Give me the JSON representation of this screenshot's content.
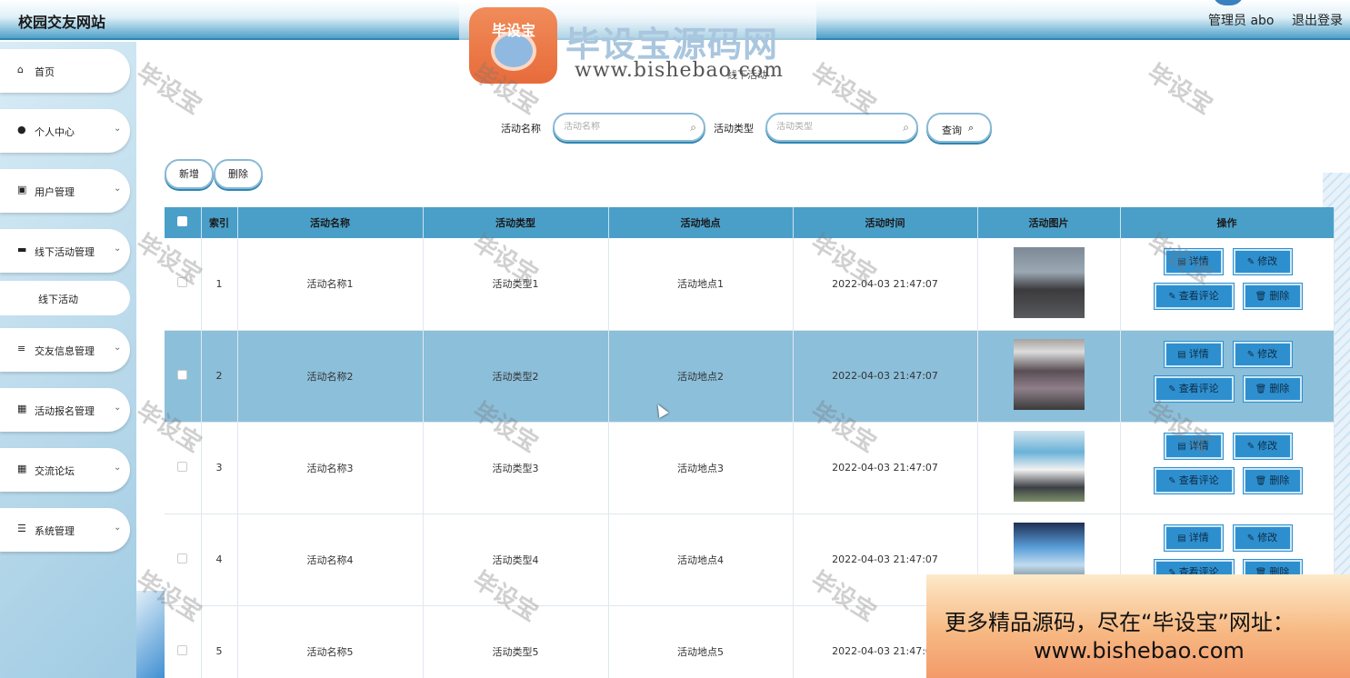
{
  "header": {
    "site_title": "校园交友网站",
    "admin_label": "管理员 abo",
    "logout_label": "退出登录"
  },
  "watermark_banner": {
    "logo_text": "毕设宝",
    "title": "毕设宝源码网",
    "url": "www.bishebao.com",
    "tile_text": "毕设宝"
  },
  "sidebar": {
    "items": [
      {
        "label": "首页",
        "icon": "home-icon"
      },
      {
        "label": "个人中心",
        "icon": "user-icon"
      },
      {
        "label": "用户管理",
        "icon": "clipboard-icon"
      },
      {
        "label": "线下活动管理",
        "icon": "briefcase-icon"
      },
      {
        "label": "交友信息管理",
        "icon": "list-icon"
      },
      {
        "label": "活动报名管理",
        "icon": "grid-icon"
      },
      {
        "label": "交流论坛",
        "icon": "grid-icon"
      },
      {
        "label": "系统管理",
        "icon": "sliders-icon"
      }
    ],
    "sub_item": "线下活动"
  },
  "breadcrumb": "线下活动",
  "search": {
    "name_label": "活动名称",
    "name_placeholder": "活动名称",
    "type_label": "活动类型",
    "type_placeholder": "活动类型",
    "query_label": "查询"
  },
  "toolbar": {
    "add_label": "新增",
    "delete_label": "删除"
  },
  "table": {
    "headers": [
      "索引",
      "活动名称",
      "活动类型",
      "活动地点",
      "活动时间",
      "活动图片",
      "操作"
    ],
    "rows": [
      {
        "index": "1",
        "name": "活动名称1",
        "type": "活动类型1",
        "place": "活动地点1",
        "time": "2022-04-03 21:47:07"
      },
      {
        "index": "2",
        "name": "活动名称2",
        "type": "活动类型2",
        "place": "活动地点2",
        "time": "2022-04-03 21:47:07"
      },
      {
        "index": "3",
        "name": "活动名称3",
        "type": "活动类型3",
        "place": "活动地点3",
        "time": "2022-04-03 21:47:07"
      },
      {
        "index": "4",
        "name": "活动名称4",
        "type": "活动类型4",
        "place": "活动地点4",
        "time": "2022-04-03 21:47:07"
      },
      {
        "index": "5",
        "name": "活动名称5",
        "type": "活动类型5",
        "place": "活动地点5",
        "time": "2022-04-03 21:47:07"
      }
    ],
    "actions": {
      "detail": "详情",
      "edit": "修改",
      "comments": "查看评论",
      "delete": "删除"
    },
    "highlight_row_index": "2"
  },
  "promo": {
    "line1": "更多精品源码，尽在“毕设宝”网址：",
    "line2": "www.bishebao.com"
  },
  "colors": {
    "header_accent": "#2f86b2",
    "table_header": "#4a9fc9",
    "highlight_row": "#8cbfda",
    "action_button": "#2e8fcf"
  }
}
